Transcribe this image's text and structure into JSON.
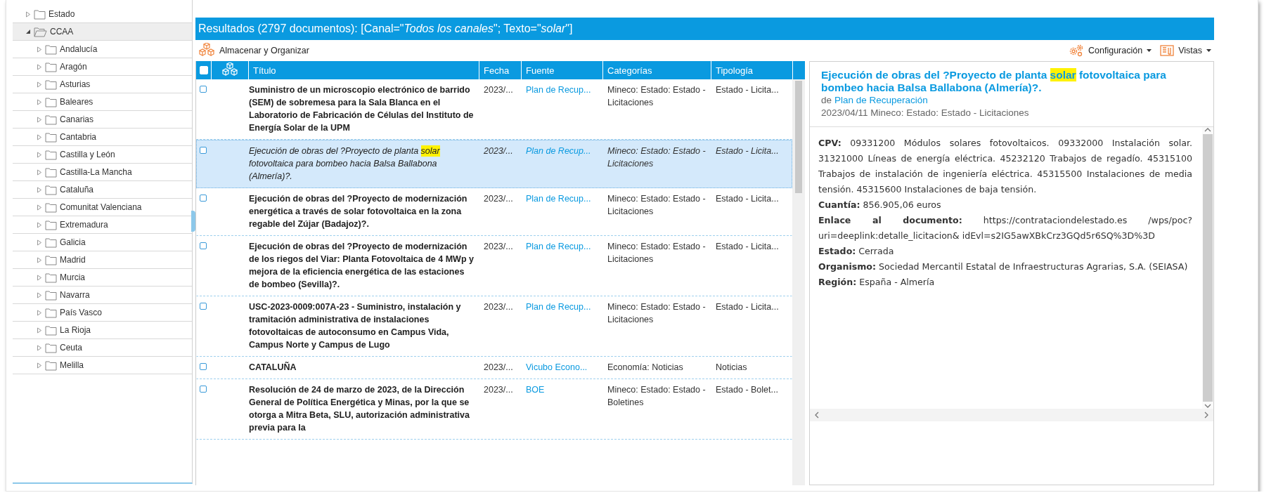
{
  "tree": [
    {
      "label": "Estado",
      "expanded": false,
      "selected": false
    },
    {
      "label": "CCAA",
      "expanded": true,
      "selected": true,
      "children": [
        {
          "label": "Andalucía",
          "expanded": false,
          "selected": false
        },
        {
          "label": "Aragón",
          "expanded": false,
          "selected": false
        },
        {
          "label": "Asturias",
          "expanded": false,
          "selected": false
        },
        {
          "label": "Baleares",
          "expanded": false,
          "selected": false
        },
        {
          "label": "Canarias",
          "expanded": false,
          "selected": false
        },
        {
          "label": "Cantabria",
          "expanded": false,
          "selected": false
        },
        {
          "label": "Castilla y León",
          "expanded": false,
          "selected": false
        },
        {
          "label": "Castilla-La Mancha",
          "expanded": false,
          "selected": false
        },
        {
          "label": "Cataluña",
          "expanded": false,
          "selected": false
        },
        {
          "label": "Comunitat Valenciana",
          "expanded": false,
          "selected": false
        },
        {
          "label": "Extremadura",
          "expanded": false,
          "selected": false
        },
        {
          "label": "Galicia",
          "expanded": false,
          "selected": false
        },
        {
          "label": "Madrid",
          "expanded": false,
          "selected": false
        },
        {
          "label": "Murcia",
          "expanded": false,
          "selected": false
        },
        {
          "label": "Navarra",
          "expanded": false,
          "selected": false
        },
        {
          "label": "País Vasco",
          "expanded": false,
          "selected": false
        },
        {
          "label": "La Rioja",
          "expanded": false,
          "selected": false
        },
        {
          "label": "Ceuta",
          "expanded": false,
          "selected": false
        },
        {
          "label": "Melilla",
          "expanded": false,
          "selected": false
        }
      ]
    }
  ],
  "results_header": "Resultados (2797 documentos): [Canal=\"*Todos los canales*\"; Texto=\"*solar*\"]",
  "toolbar": {
    "store_button": "Almacenar y Organizar",
    "config_button": "Configuración",
    "views_button": "Vistas"
  },
  "table": {
    "select_all_checked": false,
    "columns": [
      "Título",
      "Fecha",
      "Fuente",
      "Categorías",
      "Tipología"
    ],
    "rows": [
      {
        "selected": false,
        "checked": false,
        "title": [
          {
            "text": "Suministro de un microscopio electrónico de barrido (SEM) de sobremesa para la Sala Blanca en el Laboratorio de Fabricación de Células del Instituto de Energía Solar de la UPM",
            "highlighted": false
          }
        ],
        "date": "2023/...",
        "source": "Plan de Recup...",
        "categories": "Mineco: Estado: Estado - Licitaciones",
        "type": "Estado - Licita..."
      },
      {
        "selected": true,
        "checked": false,
        "title": [
          {
            "text": "Ejecución de obras del ?Proyecto de planta ",
            "highlighted": false
          },
          {
            "text": "solar",
            "highlighted": true
          },
          {
            "text": " fotovoltaica para bombeo hacia Balsa Ballabona (Almería)?.",
            "highlighted": false
          }
        ],
        "date": "2023/...",
        "source": "Plan de Recup...",
        "categories": "Mineco: Estado: Estado - Licitaciones",
        "type": "Estado - Licita..."
      },
      {
        "selected": false,
        "checked": false,
        "title": [
          {
            "text": "Ejecución de obras del ?Proyecto de modernización energética a través de solar fotovoltaica en la zona regable del Zújar (Badajoz)?.",
            "highlighted": false
          }
        ],
        "date": "2023/...",
        "source": "Plan de Recup...",
        "categories": "Mineco: Estado: Estado - Licitaciones",
        "type": "Estado - Licita..."
      },
      {
        "selected": false,
        "checked": false,
        "title": [
          {
            "text": "Ejecución de obras del ?Proyecto de modernización de los riegos del Viar: Planta Fotovoltaica de 4 MWp y mejora de la eficiencia energética de las estaciones de bombeo (Sevilla)?.",
            "highlighted": false
          }
        ],
        "date": "2023/...",
        "source": "Plan de Recup...",
        "categories": "Mineco: Estado: Estado - Licitaciones",
        "type": "Estado - Licita..."
      },
      {
        "selected": false,
        "checked": false,
        "title": [
          {
            "text": "USC-2023-0009:007A-23 - Suministro, instalación y tramitación administrativa de instalaciones fotovoltaicas de autoconsumo en Campus Vida, Campus Norte y Campus de Lugo",
            "highlighted": false
          }
        ],
        "date": "2023/...",
        "source": "Plan de Recup...",
        "categories": "Mineco: Estado: Estado - Licitaciones",
        "type": "Estado - Licita..."
      },
      {
        "selected": false,
        "checked": false,
        "title": [
          {
            "text": "CATALUÑA",
            "highlighted": false
          }
        ],
        "date": "2023/...",
        "source": "Vicubo Econo...",
        "categories": "Economía: Noticias",
        "type": "Noticias"
      },
      {
        "selected": false,
        "checked": false,
        "title": [
          {
            "text": "Resolución de 24 de marzo de 2023, de la Dirección General de Política Energética y Minas, por la que se otorga a Mitra Beta, SLU, autorización administrativa previa para la",
            "highlighted": false
          }
        ],
        "date": "2023/...",
        "source": "BOE",
        "categories": "Mineco: Estado: Estado - Boletines",
        "type": "Estado - Bolet..."
      }
    ]
  },
  "detail": {
    "title": [
      {
        "text": "Ejecución de obras del ?Proyecto de planta ",
        "highlighted": false
      },
      {
        "text": "solar",
        "highlighted": true
      },
      {
        "text": " fotovoltaica para bombeo hacia Balsa Ballabona (Almería)?.",
        "highlighted": false
      }
    ],
    "source_prefix": "de",
    "source": "Plan de Recuperación",
    "meta": "2023/04/11 Mineco: Estado: Estado - Licitaciones",
    "fields": [
      "**CPV:** 09331200 Módulos solares fotovoltaicos. 09332000 Instalación solar. 31321000 Líneas de energía eléctrica. 45232120 Trabajos de regadío. 45315100 Trabajos de instalación de ingeniería eléctrica. 45315500 Instalaciones de media tensión. 45315600 Instalaciones de baja tensión.",
      "**Cuantía:** 856.905,06 euros",
      "**Enlace al documento:** https://contrataciondelestado.es /wps/poc?uri=deeplink:detalle_licitacion& idEvl=s2IG5awXBkCrz3GQd5r6SQ%3D%3D",
      "**Estado:** Cerrada",
      "**Organismo:** Sociedad Mercantil Estatal de Infraestructuras Agrarias, S.A. (SEIASA)",
      "**Región:** España - Almería"
    ]
  }
}
